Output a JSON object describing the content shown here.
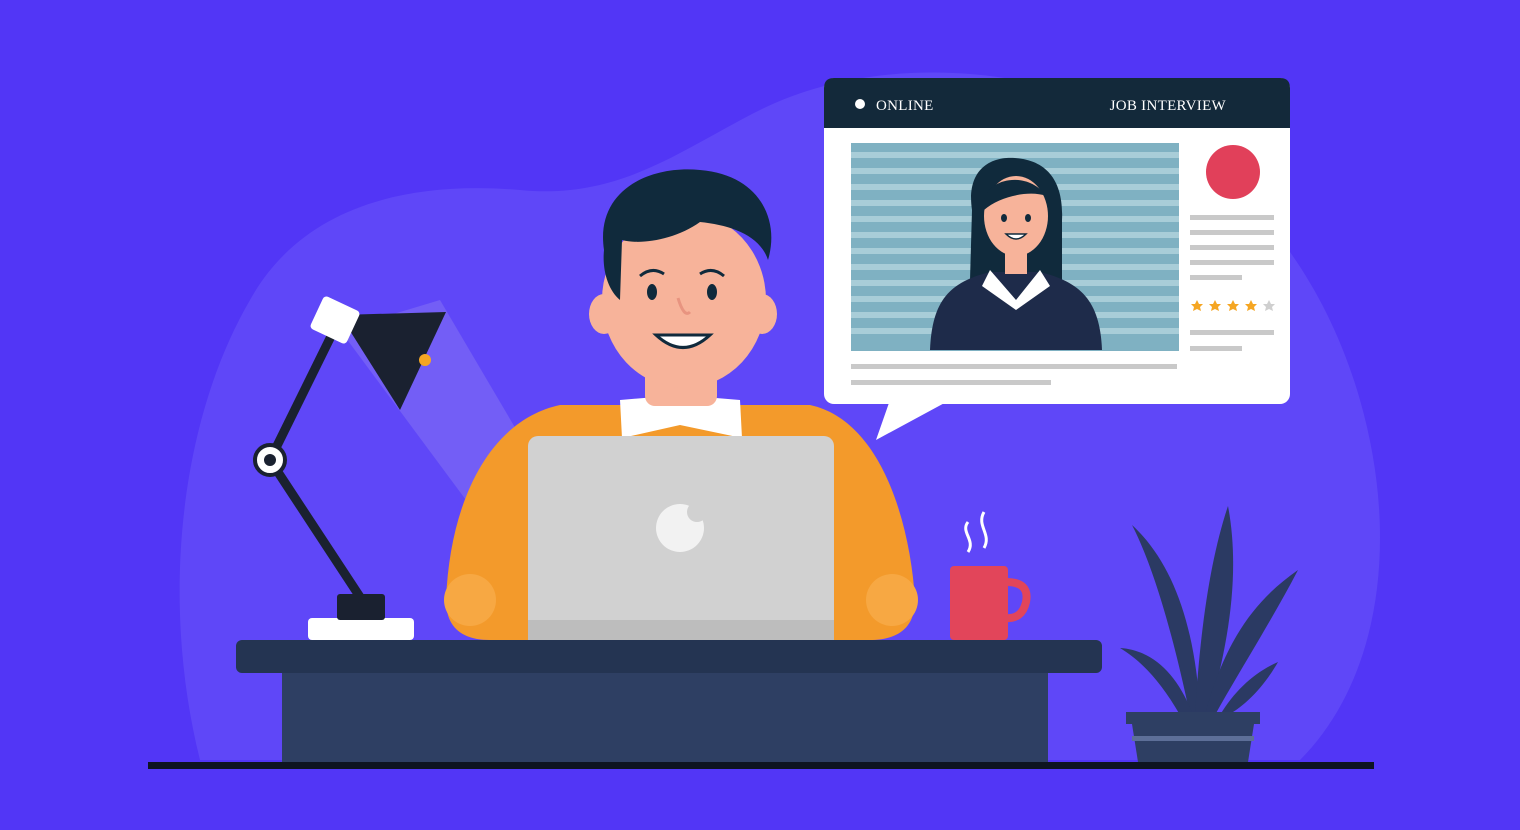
{
  "scene": {
    "description_label": "Online job interview illustration",
    "colors": {
      "background": "#5236F6",
      "blob": "#5F47F8",
      "lamp_light": "#7A66F5",
      "shirt": "#F39A2B",
      "laptop": "#D1D1D1",
      "desk": "#2E3F63",
      "floor": "#0E1420",
      "mug": "#E2455A",
      "plant": "#2B3A63",
      "window_header": "#13293A",
      "record_dot": "#E1405A",
      "stars": "#F5A623"
    },
    "icons": [
      "desk-lamp-icon",
      "laptop-icon",
      "coffee-mug-icon",
      "plant-icon",
      "record-icon"
    ]
  },
  "window": {
    "status_label": "ONLINE",
    "title_label": "JOB INTERVIEW",
    "rating": {
      "filled": 4,
      "total": 5
    }
  }
}
